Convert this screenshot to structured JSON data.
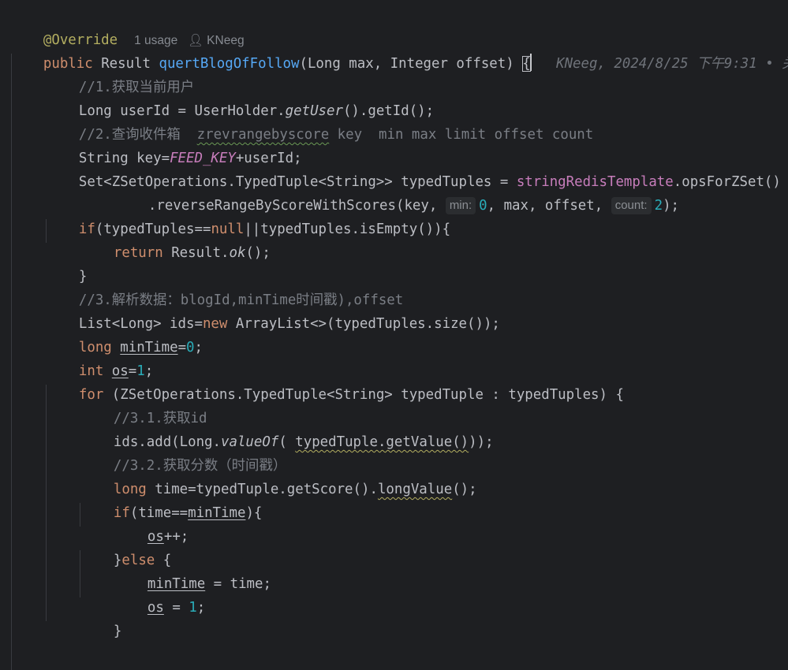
{
  "editor": {
    "language": "java",
    "theme_bg": "#1e1f22",
    "header": {
      "annotation": "@Override",
      "usages": "1 usage",
      "author_icon": "person-icon",
      "author": "KNeeg"
    },
    "blame": "KNeeg, 2024/8/25 下午9:31 • 关",
    "lines": {
      "l1_kw": "public",
      "l1_type": " Result ",
      "l1_fn": "quertBlogOfFollow",
      "l1_params": "(Long max, Integer offset) ",
      "l1_brace": "{",
      "l2": "//1.获取当前用户",
      "l3_a": "Long userId = UserHolder.",
      "l3_b": "getUser",
      "l3_c": "().getId();",
      "l4_a": "//2.查询收件箱  ",
      "l4_b": "zrevrangebyscore",
      "l4_c": " key  min max limit offset count",
      "l5_a": "String key=",
      "l5_b": "FEED_KEY",
      "l5_c": "+userId;",
      "l6_a": "Set<ZSetOperations.TypedTuple<String>> typedTuples = ",
      "l6_b": "stringRedisTemplate",
      "l6_c": ".opsForZSet()",
      "l7_a": ".reverseRangeByScoreWithScores(key, ",
      "l7_hint1": "min:",
      "l7_v1": "0",
      "l7_b": ", max, offset, ",
      "l7_hint2": "count:",
      "l7_v2": "2",
      "l7_c": ");",
      "l8_kw": "if",
      "l8_a": "(typedTuples==",
      "l8_null": "null",
      "l8_b": "||typedTuples.isEmpty()){",
      "l9_kw": "return",
      "l9_a": " Result.",
      "l9_b": "ok",
      "l9_c": "();",
      "l10": "}",
      "l11": "//3.解析数据：blogId,minTime时间戳),offset",
      "l12_a": "List<Long> ids=",
      "l12_kw": "new",
      "l12_b": " ArrayList<>(typedTuples.size());",
      "l13_kw": "long",
      "l13_var": "minTime",
      "l13_a": "=",
      "l13_num": "0",
      "l13_b": ";",
      "l14_kw": "int",
      "l14_var": "os",
      "l14_a": "=",
      "l14_num": "1",
      "l14_b": ";",
      "l15_kw": "for",
      "l15_a": " (ZSetOperations.TypedTuple<String> typedTuple : typedTuples) {",
      "l16": "//3.1.获取id",
      "l17_a": "ids.add(Long.",
      "l17_b": "valueOf",
      "l17_c": "( ",
      "l17_d": "typedTuple.getValue()",
      "l17_e": "));",
      "l18": "//3.2.获取分数（时间戳）",
      "l19_kw": "long",
      "l19_a": " time=typedTuple.getScore().",
      "l19_b": "longValue",
      "l19_c": "();",
      "l20_kw": "if",
      "l20_a": "(time==",
      "l20_var": "minTime",
      "l20_b": "){",
      "l21_var": "os",
      "l21_a": "++;",
      "l22_a": "}",
      "l22_kw": "else",
      "l22_b": " {",
      "l23_var": "minTime",
      "l23_a": " = time;",
      "l24_var": "os",
      "l24_a": " = ",
      "l24_num": "1",
      "l24_b": ";",
      "l25": "}",
      "l27": "}"
    }
  }
}
